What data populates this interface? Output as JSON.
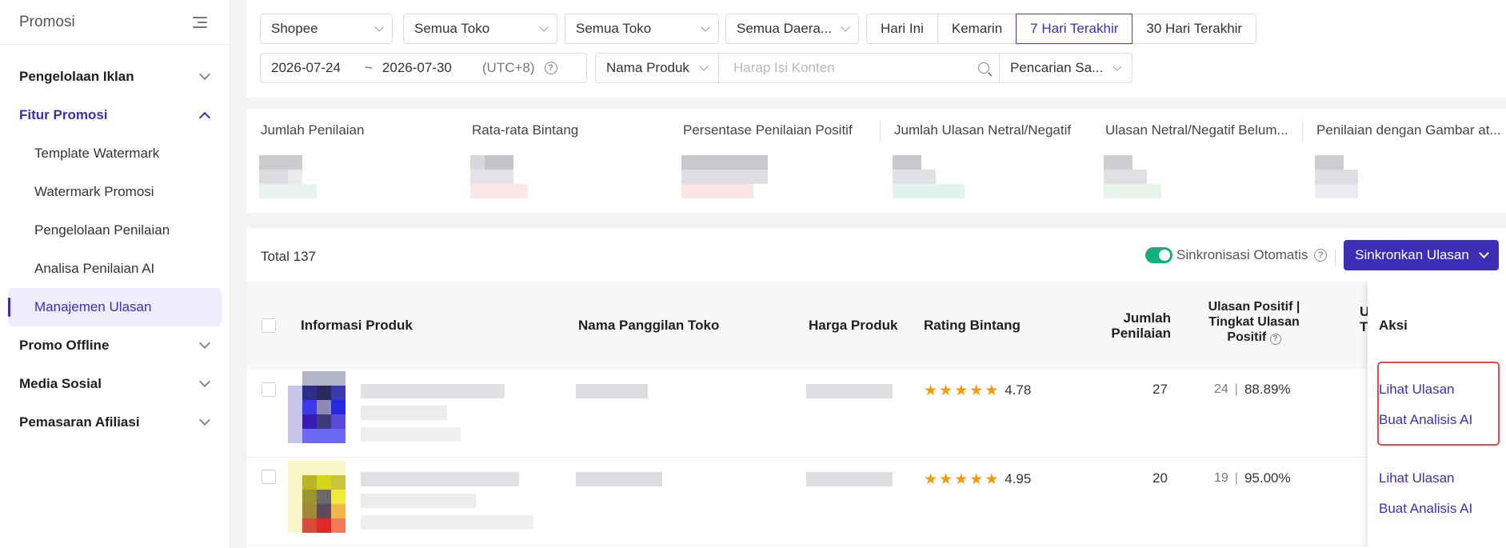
{
  "sidebar": {
    "title": "Promosi",
    "groups": [
      {
        "label": "Pengelolaan Iklan"
      },
      {
        "label": "Fitur Promosi"
      },
      {
        "label": "Promo Offline"
      },
      {
        "label": "Media Sosial"
      },
      {
        "label": "Pemasaran Afiliasi"
      }
    ],
    "sub_items": [
      {
        "label": "Template Watermark"
      },
      {
        "label": "Watermark Promosi"
      },
      {
        "label": "Pengelolaan Penilaian"
      },
      {
        "label": "Analisa Penilaian AI"
      },
      {
        "label": "Manajemen Ulasan"
      }
    ]
  },
  "filters": {
    "platform": "Shopee",
    "store1": "Semua Toko",
    "store2": "Semua Toko",
    "region": "Semua Daera...",
    "ranges": [
      "Hari Ini",
      "Kemarin",
      "7 Hari Terakhir",
      "30 Hari Terakhir"
    ],
    "date_start": "2026-07-24",
    "date_sep": "~",
    "date_end": "2026-07-30",
    "timezone": "(UTC+8)",
    "search_type": "Nama Produk",
    "search_placeholder": "Harap Isi Konten",
    "search_mode": "Pencarian Sa..."
  },
  "metrics": [
    {
      "label": "Jumlah Penilaian"
    },
    {
      "label": "Rata-rata Bintang"
    },
    {
      "label": "Persentase Penilaian Positif"
    },
    {
      "label": "Jumlah Ulasan Netral/Negatif"
    },
    {
      "label": "Ulasan Netral/Negatif Belum..."
    },
    {
      "label": "Penilaian dengan Gambar at..."
    }
  ],
  "table": {
    "total": "Total 137",
    "auto_sync_label": "Sinkronisasi Otomatis",
    "sync_button": "Sinkronkan Ulasan",
    "headers": {
      "product": "Informasi Produk",
      "store": "Nama Panggilan Toko",
      "price": "Harga Produk",
      "rating": "Rating Bintang",
      "count_l1": "Jumlah",
      "count_l2": "Penilaian",
      "positive_l1": "Ulasan Positif |",
      "positive_l2": "Tingkat Ulasan",
      "positive_l3": "Positif",
      "cut_l1": "U",
      "cut_l2": "T",
      "actions": "Aksi"
    },
    "rows": [
      {
        "rating": "4.78",
        "stars": 5,
        "count": "27",
        "positive": "24",
        "sep": "|",
        "rate": "88.89%",
        "action1": "Lihat Ulasan",
        "action2": "Buat Analisis AI"
      },
      {
        "rating": "4.95",
        "stars": 5,
        "count": "20",
        "positive": "19",
        "sep": "|",
        "rate": "95.00%",
        "action1": "Lihat Ulasan",
        "action2": "Buat Analisis AI"
      }
    ]
  },
  "colors": {
    "primary": "#3d2fb3",
    "toggle_on": "#14b07b",
    "star": "#f59a0c",
    "highlight": "#e34b4b"
  }
}
